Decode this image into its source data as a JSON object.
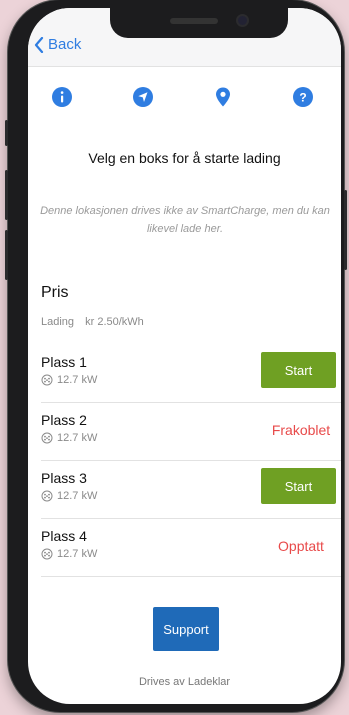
{
  "navbar": {
    "back_label": "Back"
  },
  "icons": [
    "info-icon",
    "navigate-icon",
    "location-pin-icon",
    "help-icon"
  ],
  "title": "Velg en boks for å starte lading",
  "notice": "Denne lokasjonen drives ikke av SmartCharge, men du kan likevel lade her.",
  "pris": {
    "heading": "Pris",
    "label": "Lading",
    "value": "kr 2.50/kWh"
  },
  "stations": [
    {
      "name": "Plass 1",
      "power": "12.7 kW",
      "action": "Start"
    },
    {
      "name": "Plass 2",
      "power": "12.7 kW",
      "status": "Frakoblet"
    },
    {
      "name": "Plass 3",
      "power": "12.7 kW",
      "action": "Start"
    },
    {
      "name": "Plass 4",
      "power": "12.7 kW",
      "status": "Opptatt"
    }
  ],
  "support_label": "Support",
  "footer": "Drives av Ladeklar",
  "colors": {
    "accent": "#2f7de1",
    "start": "#6fa023",
    "alert": "#e84a4a",
    "support": "#1f6ab8"
  }
}
